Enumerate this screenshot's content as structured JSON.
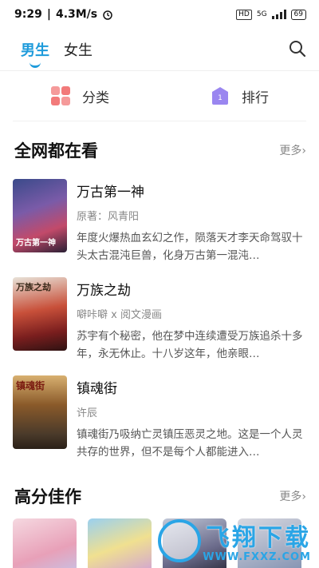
{
  "status_bar": {
    "time": "9:29",
    "speed": "4.3M/s",
    "hd": "HD",
    "network": "5G",
    "battery": "69"
  },
  "tabs": [
    {
      "label": "男生"
    },
    {
      "label": "女生"
    }
  ],
  "quick_nav": [
    {
      "label": "分类",
      "icon": "category-grid-icon"
    },
    {
      "label": "排行",
      "icon": "ranking-icon",
      "badge": "1"
    }
  ],
  "section1": {
    "title": "全网都在看",
    "more": "更多›",
    "items": [
      {
        "title": "万古第一神",
        "author": "原著：风青阳",
        "desc": "年度火爆热血玄幻之作，陨落天才李天命驾驭十头太古混沌巨兽，化身万古第一混沌…",
        "cover_text": "万古第一神"
      },
      {
        "title": "万族之劫",
        "author": "噼咔噼 x 阅文漫画",
        "desc": "苏宇有个秘密，他在梦中连续遭受万族追杀十多年，永无休止。十八岁这年，他亲眼…",
        "cover_text": "万族之劫"
      },
      {
        "title": "镇魂街",
        "author": "许辰",
        "desc": "镇魂街乃吸纳亡灵镇压恶灵之地。这是一个人灵共存的世界，但不是每个人都能进入…",
        "cover_text": "镇魂街"
      }
    ]
  },
  "section2": {
    "title": "高分佳作",
    "more": "更多›"
  },
  "watermark": {
    "big": "飞翔下载",
    "small": "WWW.FXXZ.COM"
  },
  "colors": {
    "accent": "#1e9bdb"
  }
}
